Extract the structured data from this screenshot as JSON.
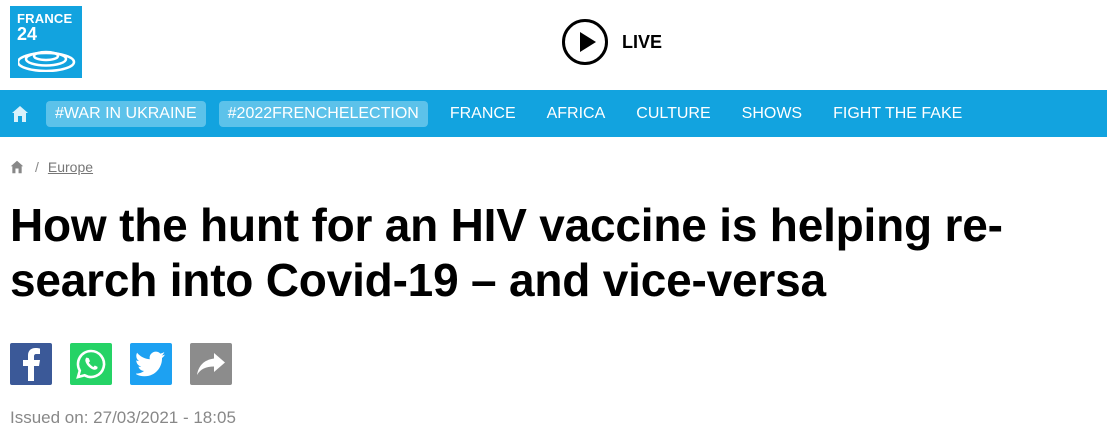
{
  "logo": {
    "line1": "FRANCE",
    "line2": "24"
  },
  "live": {
    "label": "LIVE"
  },
  "nav": {
    "tags": [
      "#WAR IN UKRAINE",
      "#2022FRENCHELECTION"
    ],
    "items": [
      "FRANCE",
      "AFRICA",
      "CULTURE",
      "SHOWS",
      "FIGHT THE FAKE"
    ]
  },
  "breadcrumb": {
    "separator": "/",
    "section": "Europe"
  },
  "article": {
    "title": "How the hunt for an HIV vaccine is helping re-search into Covid-19 – and vice-versa",
    "issued": "Issued on: 27/03/2021 - 18:05"
  },
  "share": {
    "icons": [
      "facebook-icon",
      "whatsapp-icon",
      "twitter-icon",
      "share-icon"
    ]
  },
  "colors": {
    "brand": "#12a3df",
    "tag_bg": "#5cc2ea",
    "facebook": "#3b5998",
    "whatsapp": "#25d366",
    "twitter": "#1da1f2",
    "share": "#8c8c8c"
  }
}
